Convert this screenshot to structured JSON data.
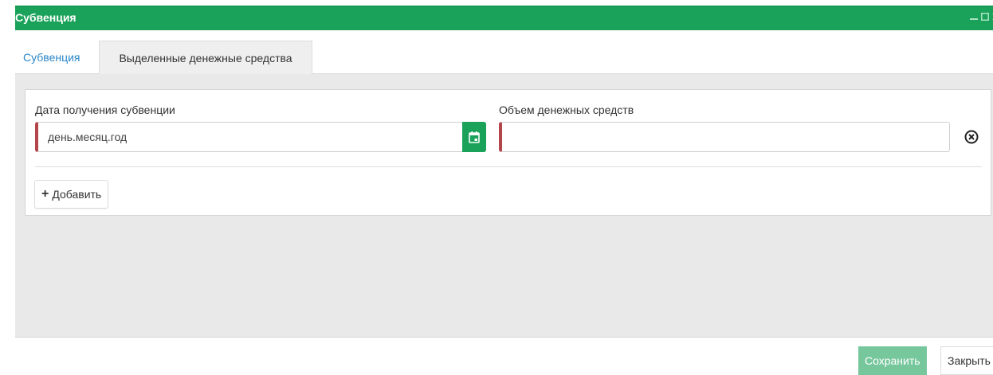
{
  "window": {
    "title": "Субвенция",
    "accent_color": "#1aa25a",
    "controls": [
      "minimize-icon",
      "maximize-icon",
      "close-icon"
    ]
  },
  "tabs": [
    {
      "label": "Субвенция",
      "active": false
    },
    {
      "label": "Выделенные денежные средства",
      "active": true
    }
  ],
  "form": {
    "date_label": "Дата получения субвенции",
    "date_placeholder": "день.месяц.год",
    "date_value": "",
    "amount_label": "Объем денежных средств",
    "amount_placeholder": "",
    "amount_value": "",
    "required_marker_color": "#b4464b",
    "calendar_icon": "calendar-icon",
    "remove_icon": "remove-circle-icon",
    "add_label": "Добавить"
  },
  "footer": {
    "save_label": "Сохранить",
    "close_label": "Закрыть"
  }
}
